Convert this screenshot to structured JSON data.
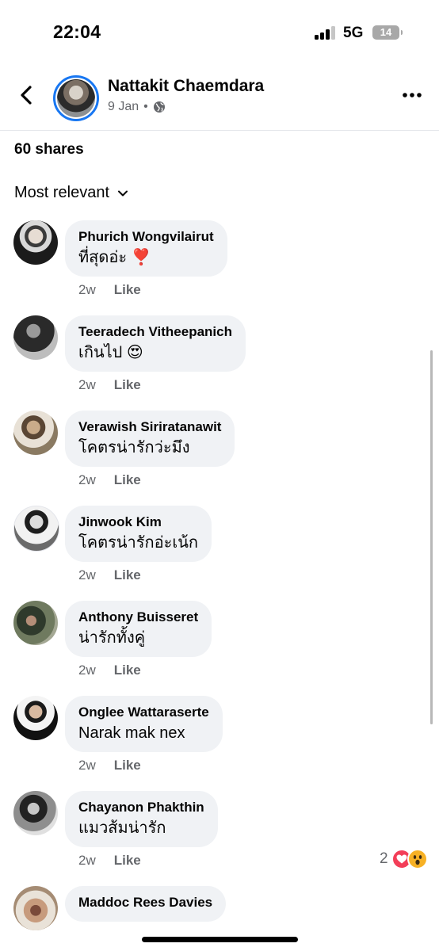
{
  "status_bar": {
    "time": "22:04",
    "network": "5G",
    "battery": "14"
  },
  "header": {
    "author": "Nattakit Chaemdara",
    "date": "9 Jan",
    "separator": "•",
    "audience_icon": "globe-icon"
  },
  "shares": "60 shares",
  "sort": {
    "label": "Most relevant"
  },
  "comments": [
    {
      "name": "Phurich Wongvilairut",
      "text": "ที่สุดอ่ะ ❣️",
      "time": "2w",
      "like": "Like"
    },
    {
      "name": "Teeradech Vitheepanich",
      "text": "เกินไป 😍",
      "time": "2w",
      "like": "Like"
    },
    {
      "name": "Verawish Siriratanawit",
      "text": "โคตรน่ารักว่ะมึง",
      "time": "2w",
      "like": "Like"
    },
    {
      "name": "Jinwook Kim",
      "text": "โคตรน่ารักอ่ะเน้ก",
      "time": "2w",
      "like": "Like"
    },
    {
      "name": "Anthony Buisseret",
      "text": "น่ารักทั้งคู่",
      "time": "2w",
      "like": "Like"
    },
    {
      "name": "Onglee Wattaraserte",
      "text": "Narak mak nex",
      "time": "2w",
      "like": "Like"
    },
    {
      "name": "Chayanon Phakthin",
      "text": "แมวส้มน่ารัก",
      "time": "2w",
      "like": "Like",
      "reaction_count": "2"
    },
    {
      "name": "Maddoc Rees Davies",
      "text": "",
      "time": "",
      "like": ""
    }
  ],
  "colors": {
    "accent": "#1877f2",
    "bubble": "#f0f2f5",
    "secondary_text": "#65676b"
  }
}
